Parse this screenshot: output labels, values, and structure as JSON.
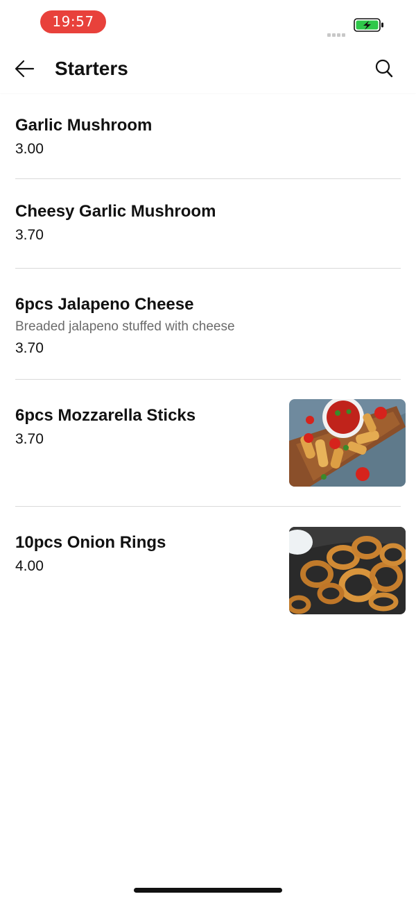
{
  "status_bar": {
    "time": "19:57",
    "battery_icon": "battery-charging-icon",
    "battery_color": "#2ec84a",
    "pill_color": "#e8413b"
  },
  "header": {
    "title": "Starters",
    "back_icon": "arrow-left-icon",
    "search_icon": "search-icon"
  },
  "items": [
    {
      "name": "Garlic Mushroom",
      "description": "",
      "price": "3.00",
      "image": null
    },
    {
      "name": "Cheesy Garlic Mushroom",
      "description": "",
      "price": "3.70",
      "image": null
    },
    {
      "name": "6pcs Jalapeno Cheese",
      "description": "Breaded jalapeno stuffed with cheese",
      "price": "3.70",
      "image": null
    },
    {
      "name": "6pcs Mozzarella Sticks",
      "description": "",
      "price": "3.70",
      "image": "mozzarella-sticks-photo"
    },
    {
      "name": "10pcs Onion Rings",
      "description": "",
      "price": "4.00",
      "image": "onion-rings-photo"
    }
  ]
}
